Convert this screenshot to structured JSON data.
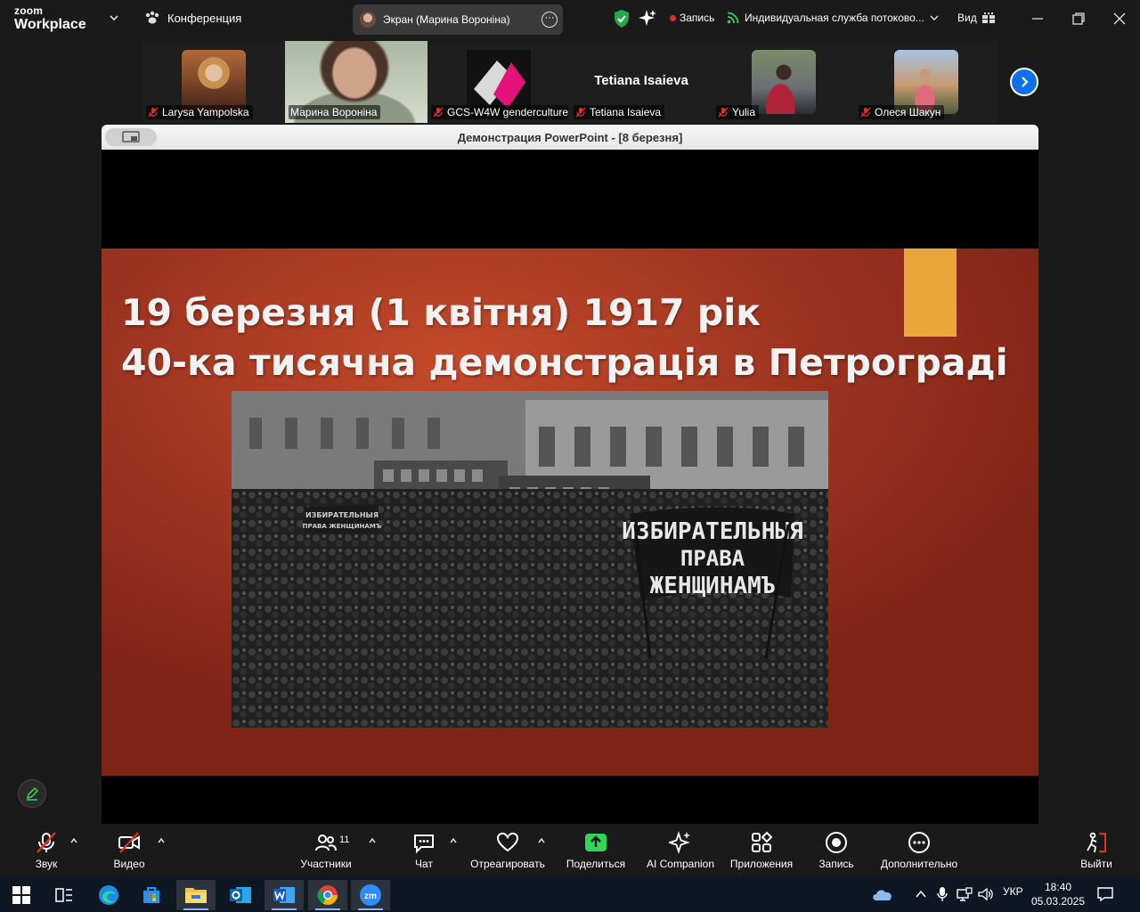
{
  "titlebar": {
    "brand_small": "zoom",
    "brand_big": "Workplace",
    "conference": "Конференция",
    "screen_share_label": "Экран (Марина Воронiна)",
    "recording": "Запись",
    "stream": "Индивидуальная служба потоково...",
    "view": "Вид"
  },
  "participants": [
    {
      "name": "Larysa Yampolska",
      "muted": true,
      "active": false
    },
    {
      "name": "Марина Воронiна",
      "muted": false,
      "active": true
    },
    {
      "name": "GCS-W4W genderculture",
      "muted": true,
      "active": false
    },
    {
      "name": "Tetiana Isaieva",
      "muted": true,
      "active": false,
      "big_name": "Tetiana Isaieva"
    },
    {
      "name": "Yulia",
      "muted": true,
      "active": false
    },
    {
      "name": "Олеся Шакун",
      "muted": true,
      "active": false
    }
  ],
  "share": {
    "window_title": "Демонстрация PowerPoint - [8 березня]",
    "slide": {
      "title_line1": "19 березня (1 квітня) 1917 рік",
      "title_line2": "40-ка тисячна демонстрація в Петрограді",
      "banner_line1": "ИЗБИРАТЕЛЬНЫЯ",
      "banner_line2": "ПРАВА",
      "banner_line3": "ЖЕНЩИНАМЪ",
      "banner_small1": "ИЗБИРАТЕЛЬНЫЯ",
      "banner_small2": "ПРАВА ЖЕНЩИНАМЪ",
      "accent_color": "#eaa53b"
    }
  },
  "toolbar": {
    "audio": "Звук",
    "video": "Видео",
    "participants": "Участники",
    "participants_count": "11",
    "chat": "Чат",
    "react": "Отреагировать",
    "share": "Поделиться",
    "ai": "AI Companion",
    "apps": "Приложения",
    "record": "Запись",
    "more": "Дополнительно",
    "leave": "Выйти",
    "share_color": "#2fd65a",
    "leave_color": "#e0301e"
  },
  "taskbar": {
    "lang": "УКР",
    "time": "18:40",
    "date": "05.03.2025"
  }
}
